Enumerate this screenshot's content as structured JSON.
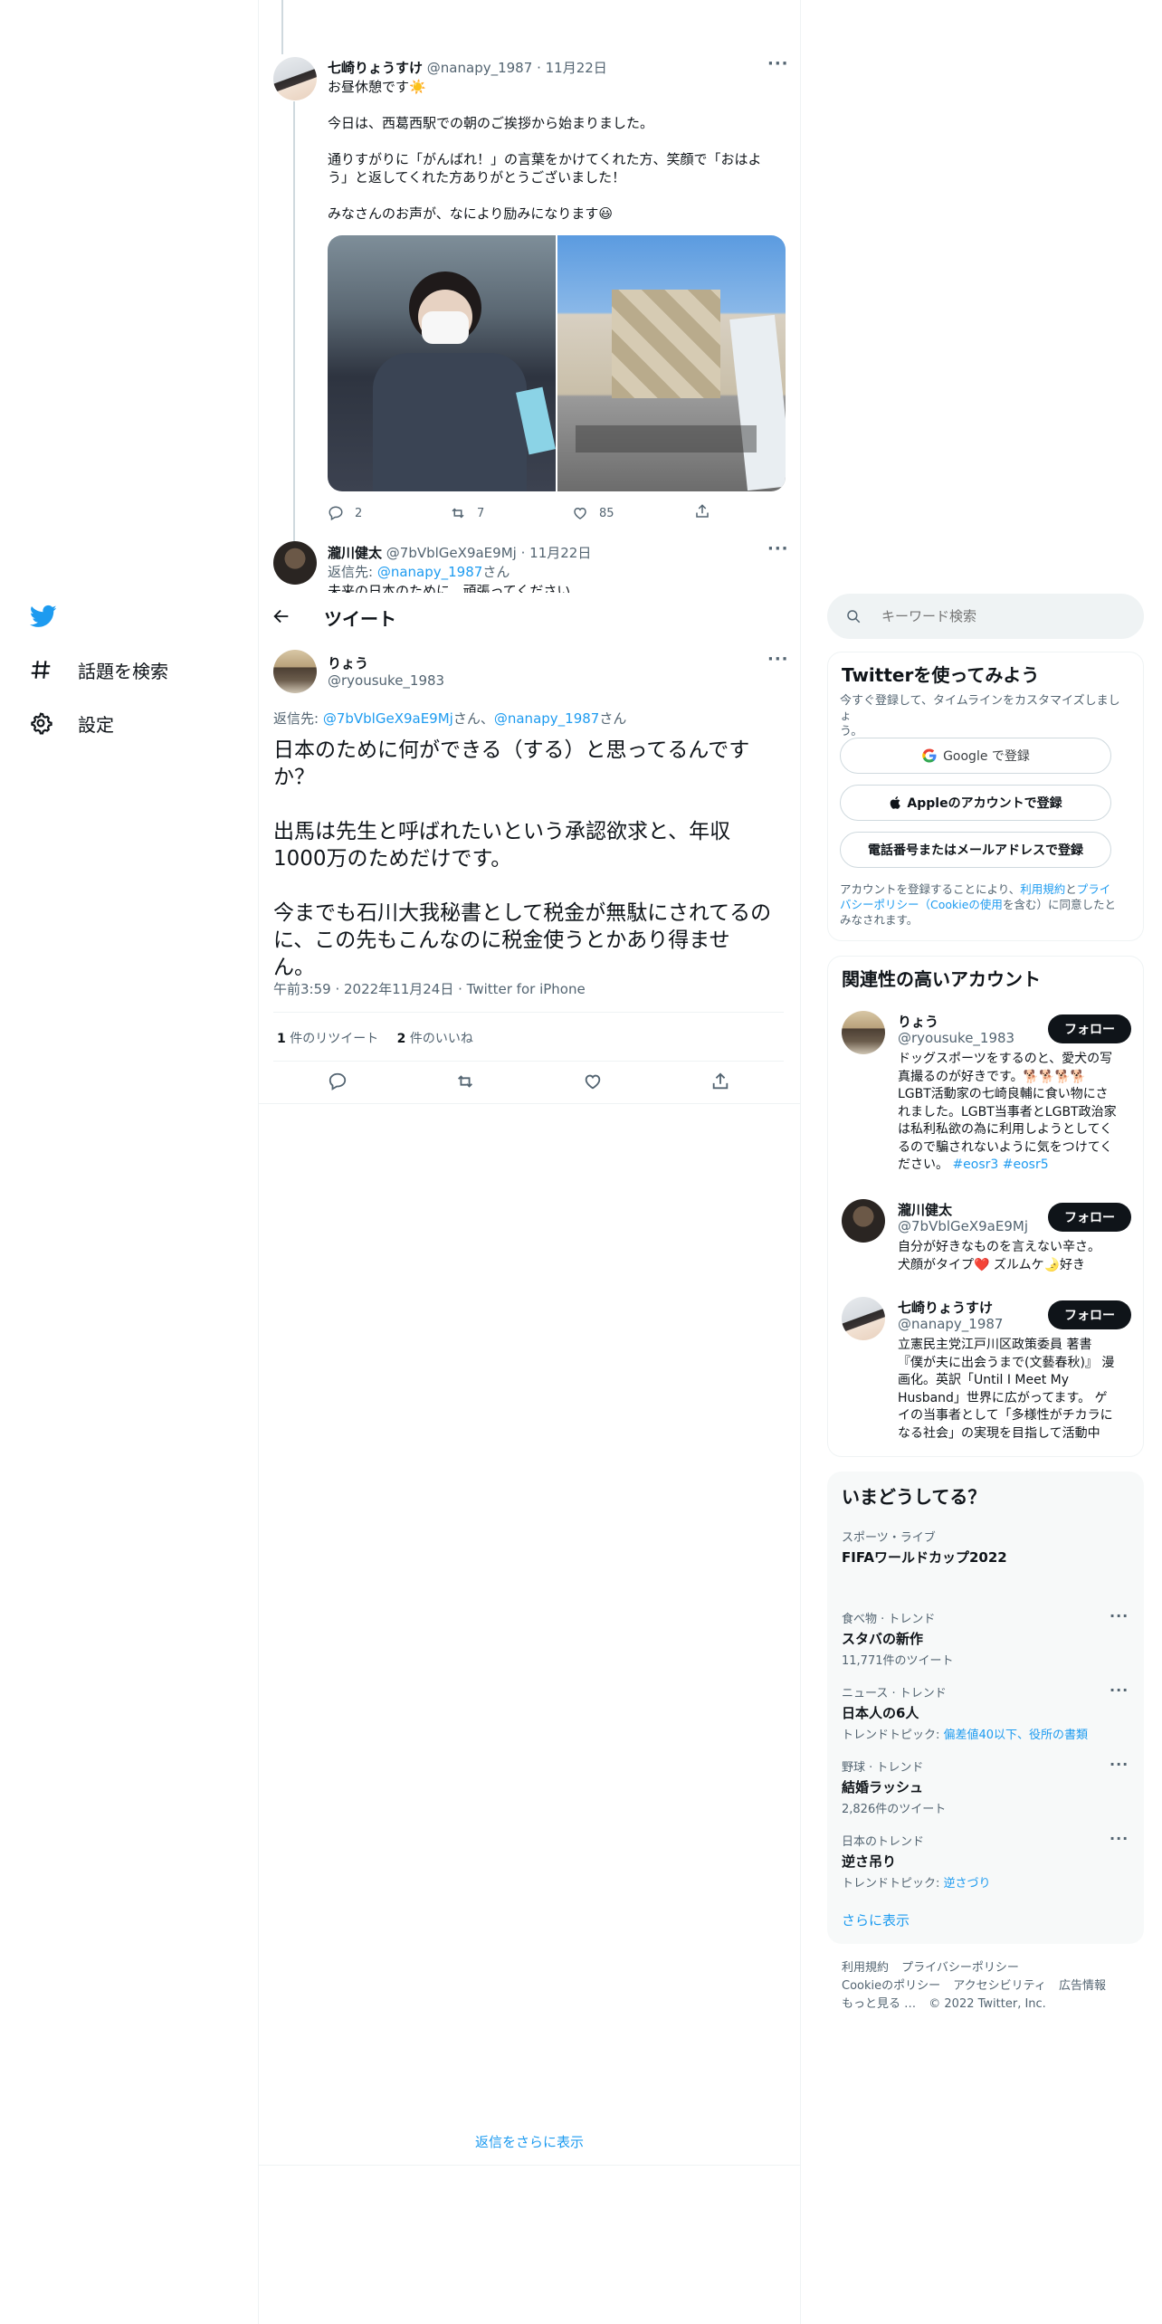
{
  "sidebar": {
    "explore_label": "話題を検索",
    "settings_label": "設定"
  },
  "thread": {
    "tweet1": {
      "name": "七崎りょうすけ",
      "handle": "@nanapy_1987",
      "sep": "·",
      "date": "11月22日",
      "line1": "お昼休憩です☀️",
      "line2": "今日は、西葛西駅での朝のご挨拶から始まりました。",
      "line3a": "通りすがりに「がんばれ！」の言葉をかけてくれた方、笑顔で「おはよ",
      "line3b": "う」と返してくれた方ありがとうございました！",
      "line4": "みなさんのお声が、なにより励みになります😃",
      "replies": "2",
      "retweets": "7",
      "likes": "85"
    },
    "tweet2": {
      "name": "瀧川健太",
      "handle": "@7bVblGeX9aE9Mj",
      "sep": "·",
      "date": "11月22日",
      "reply_prefix": "返信先: ",
      "reply_to": "@nanapy_1987",
      "reply_suffix": "さん",
      "partial": "未来の日本のために、頑張ってください"
    }
  },
  "header": {
    "title": "ツイート"
  },
  "main_tweet": {
    "name": "りょう",
    "handle": "@ryousuke_1983",
    "reply_prefix": "返信先: ",
    "reply_to1": "@7bVblGeX9aE9Mj",
    "reply_mid": "さん、",
    "reply_to2": "@nanapy_1987",
    "reply_suffix": "さん",
    "line1": "日本のために何ができる（する）と思ってるんです",
    "line2": "か？",
    "line3": "出馬は先生と呼ばれたいという承認欲求と、年収",
    "line4": "1000万のためだけです。",
    "line5": "今までも石川大我秘書として税金が無駄にされてるの",
    "line6": "に、この先もこんなのに税金使うとかあり得ませ",
    "line7": "ん。",
    "timestamp": "午前3:59 · 2022年11月24日 · Twitter for iPhone",
    "retweet_count": "1",
    "retweet_label": "件のリツイート",
    "like_count": "2",
    "like_label": "件のいいね",
    "more_replies": "返信をさらに表示"
  },
  "search": {
    "placeholder": "キーワード検索"
  },
  "signup": {
    "title": "Twitterを使ってみよう",
    "subtitle_a": "今すぐ登録して、タイムラインをカスタマイズしましょ",
    "subtitle_b": "う。",
    "google_label": "Google で登録",
    "apple_label": "Appleのアカウントで登録",
    "phone_label": "電話番号またはメールアドレスで登録",
    "legal_a1": "アカウントを登録することにより、",
    "legal_terms": "利用規約",
    "legal_and": "と",
    "legal_privacy": "プライ",
    "legal_privacy2": "バシーポリシー（Cookieの使用",
    "legal_b": "を含む）に同意したと",
    "legal_c": "みなされます。"
  },
  "related": {
    "title": "関連性の高いアカウント",
    "follow_label": "フォロー",
    "accounts": [
      {
        "name": "りょう",
        "handle": "@ryousuke_1983",
        "bio": [
          "ドッグスポーツをするのと、愛犬の写",
          "真撮るのが好きです。🐕🐕🐕🐕",
          "LGBT活動家の七崎良輔に食い物にさ",
          "れました。LGBT当事者とLGBT政治家",
          "は私利私欲の為に利用しようとしてく",
          "るので騙されないように気をつけてく",
          "ださい。"
        ],
        "tags": "#eosr3 #eosr5"
      },
      {
        "name": "瀧川健太",
        "handle": "@7bVblGeX9aE9Mj",
        "bio": [
          "自分が好きなものを言えない辛さ。",
          "犬顔がタイプ❤️ ズルムケ🌛好き"
        ]
      },
      {
        "name": "七崎りょうすけ",
        "handle": "@nanapy_1987",
        "bio": [
          "立憲民主党江戸川区政策委員 著書",
          "『僕が夫に出会うまで(文藝春秋)』 漫",
          "画化。英訳「Until I Meet My",
          "Husband」世界に広がってます。 ゲ",
          "イの当事者として「多様性がチカラに",
          "なる社会」の実現を目指して活動中"
        ]
      }
    ]
  },
  "trends": {
    "title": "いまどうしてる？",
    "items": [
      {
        "category": "スポーツ・ライブ",
        "name": "FIFAワールドカップ2022",
        "detail": ""
      },
      {
        "category": "食べ物 · トレンド",
        "name": "スタバの新作",
        "detail": "11,771件のツイート"
      },
      {
        "category": "ニュース · トレンド",
        "name": "日本人の6人",
        "detail_prefix": "トレンドトピック: ",
        "detail_link": "偏差値40以下、役所の書類"
      },
      {
        "category": "野球 · トレンド",
        "name": "結婚ラッシュ",
        "detail": "2,826件のツイート"
      },
      {
        "category": "日本のトレンド",
        "name": "逆さ吊り",
        "detail_prefix": "トレンドトピック: ",
        "detail_link": "逆さづり"
      }
    ],
    "show_more": "さらに表示"
  },
  "footer": {
    "terms": "利用規約",
    "privacy": "プライバシーポリシー",
    "cookie": "Cookieのポリシー",
    "accessibility": "アクセシビリティ",
    "ads": "広告情報",
    "more": "もっと見る …",
    "copyright": "© 2022 Twitter, Inc."
  },
  "colors": {
    "accent": "#1d9bf0",
    "text": "#0f1419",
    "secondary": "#536471",
    "border": "#eff3f4"
  }
}
